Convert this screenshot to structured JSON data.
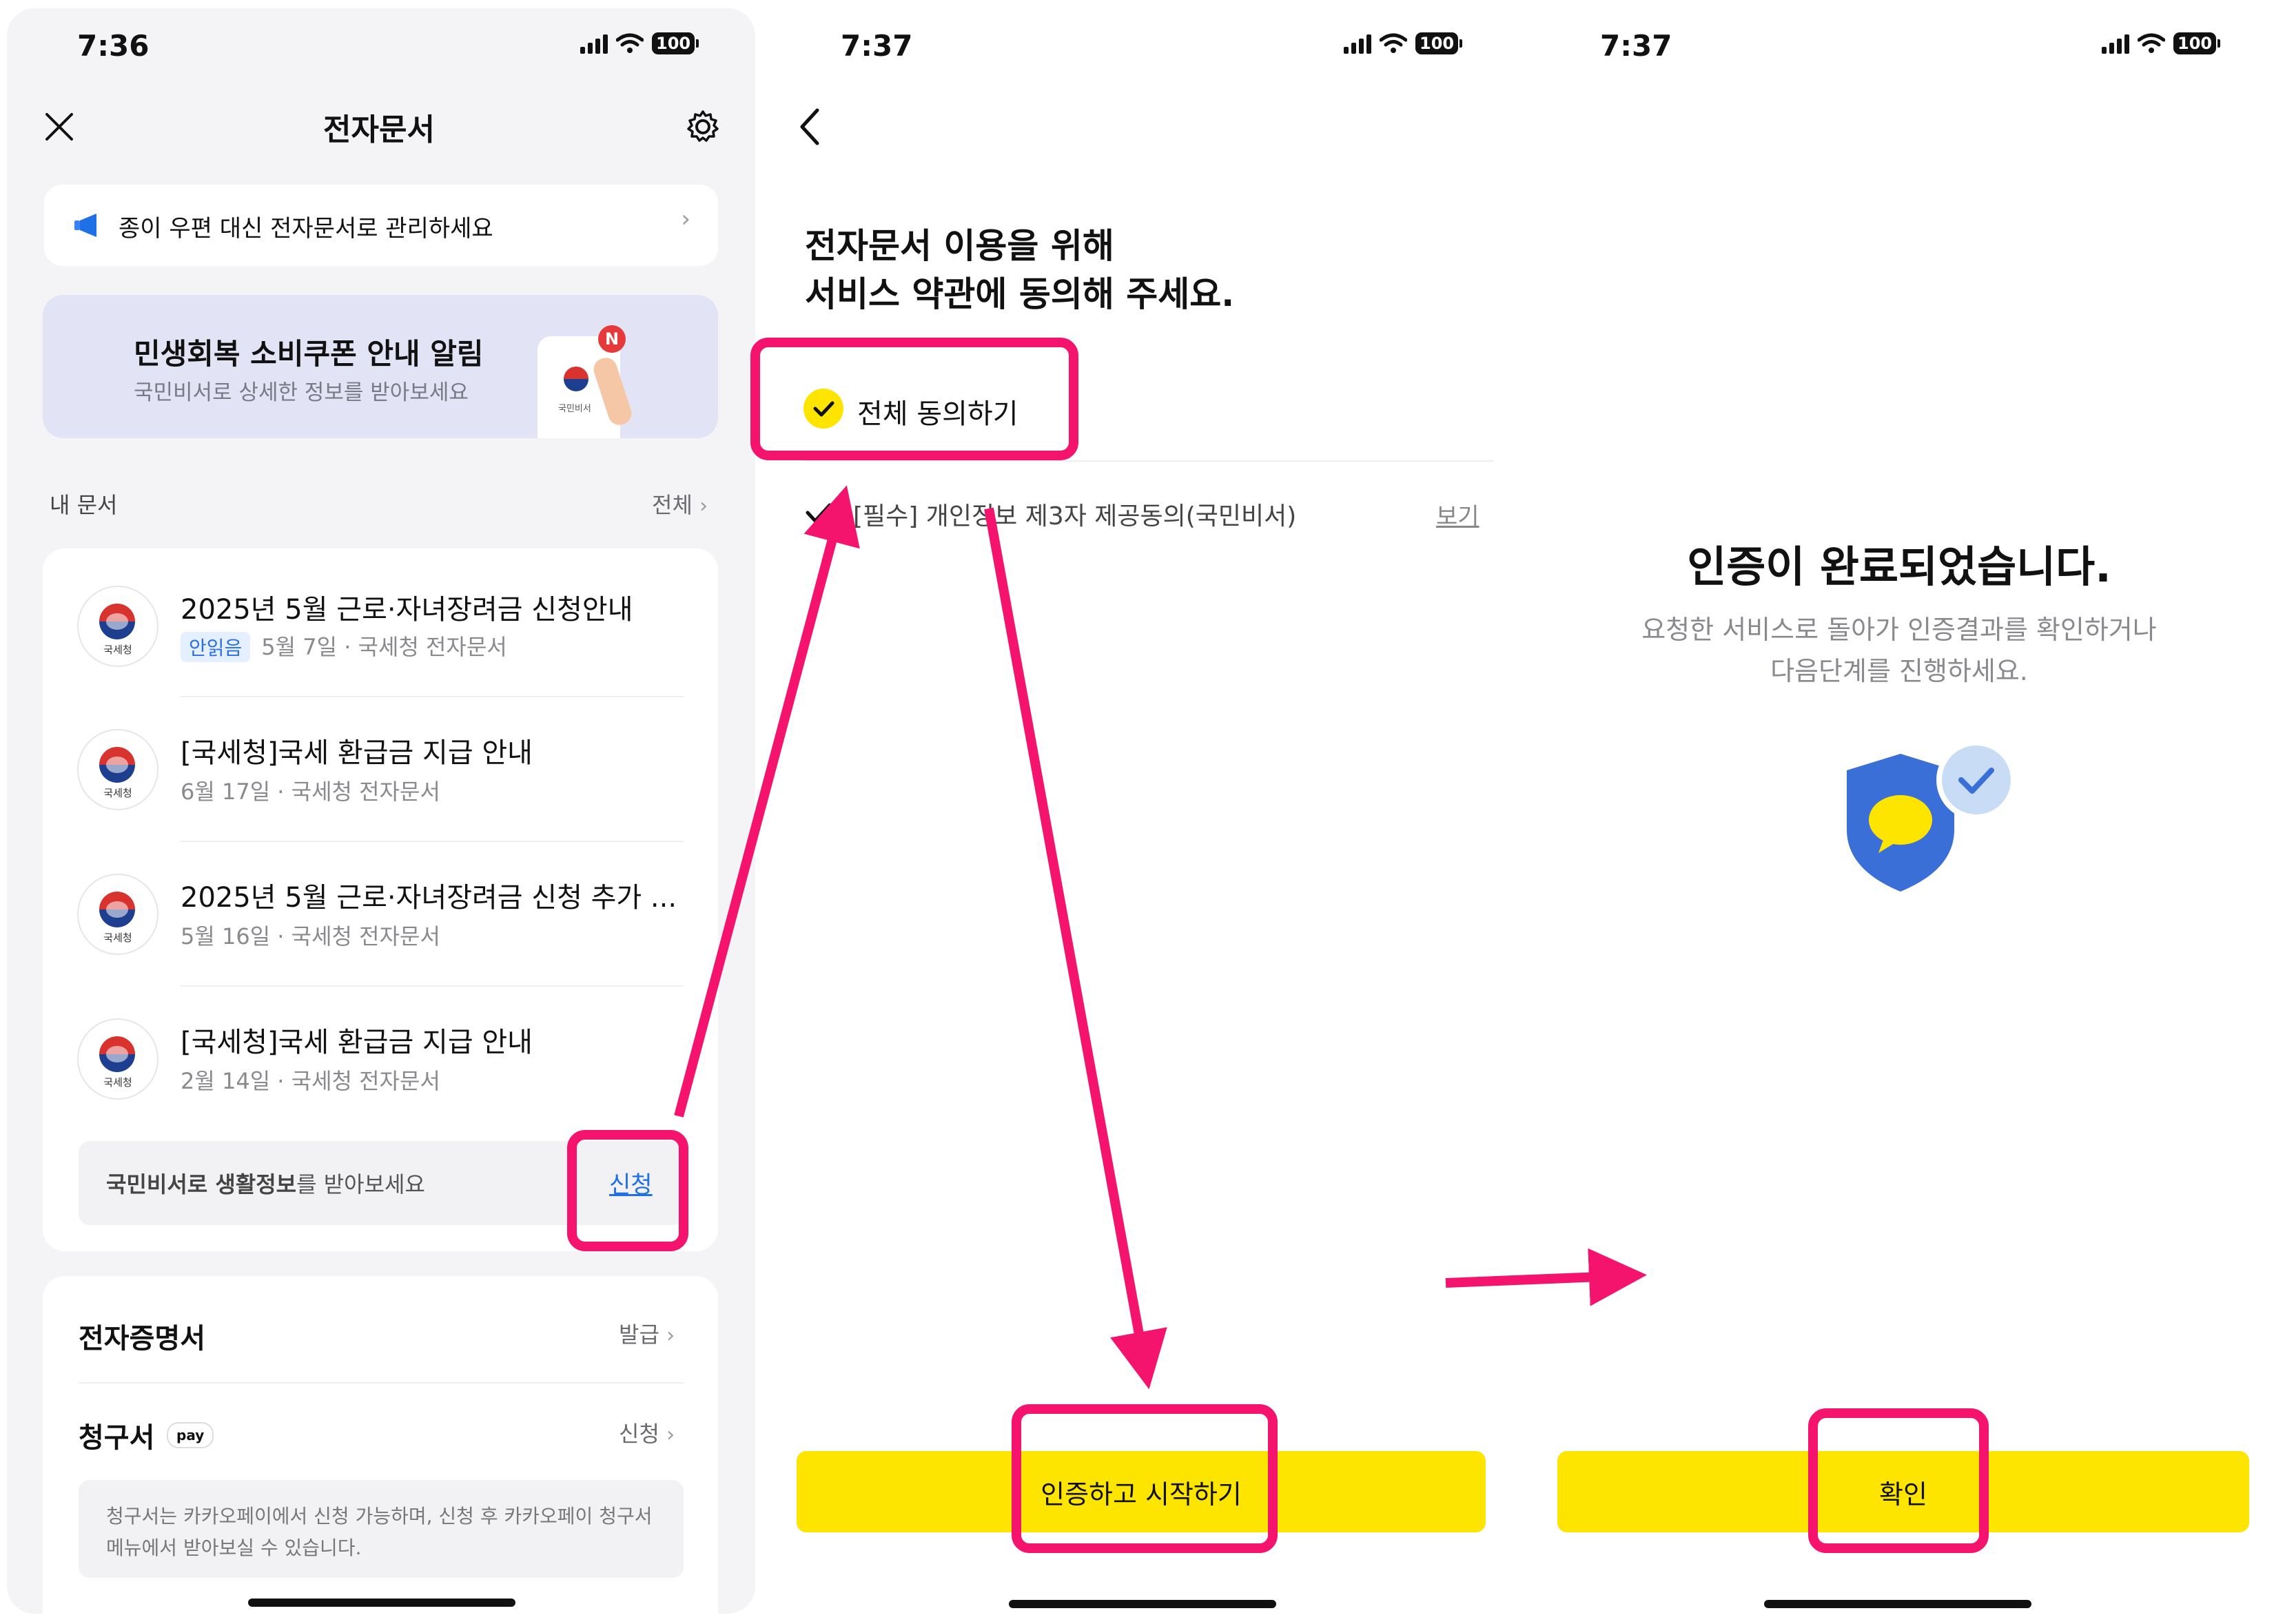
{
  "colors": {
    "accent_yellow": "#fee500",
    "highlight_pink": "#f5146d",
    "unread_blue": "#2c6fe0",
    "shield_blue": "#3b6fd8"
  },
  "screen1": {
    "time": "7:36",
    "battery": "100",
    "title": "전자문서",
    "notice": "종이 우편 대신 전자문서로 관리하세요",
    "banner": {
      "title": "민생회복 소비쿠폰 안내 알림",
      "subtitle": "국민비서로 상세한 정보를 받아보세요",
      "badge": "N",
      "phone_label": "국민비서"
    },
    "my_docs_label": "내 문서",
    "all_label": "전체",
    "docs": [
      {
        "title": "2025년 5월 근로·자녀장려금 신청안내",
        "unread": "안읽음",
        "meta": "5월 7일 · 국세청 전자문서",
        "seal": "국세청"
      },
      {
        "title": "[국세청]국세 환급금 지급 안내",
        "unread": "",
        "meta": "6월 17일 · 국세청 전자문서",
        "seal": "국세청"
      },
      {
        "title": "2025년 5월 근로·자녀장려금 신청 추가 ...",
        "unread": "",
        "meta": "5월 16일 · 국세청 전자문서",
        "seal": "국세청"
      },
      {
        "title": "[국세청]국세 환급금 지급 안내",
        "unread": "",
        "meta": "2월 14일 · 국세청 전자문서",
        "seal": "국세청"
      }
    ],
    "promo": {
      "bold": "국민비서로 생활정보",
      "rest": "를 받아보세요",
      "apply": "신청"
    },
    "cert": {
      "label": "전자증명서",
      "action": "발급"
    },
    "bill": {
      "label": "청구서",
      "badge": "pay",
      "action": "신청",
      "desc": "청구서는 카카오페이에서 신청 가능하며, 신청 후 카카오페이 청구서 메뉴에서 받아보실 수 있습니다."
    }
  },
  "screen2": {
    "time": "7:37",
    "battery": "100",
    "heading_line1": "전자문서 이용을 위해",
    "heading_line2": "서비스 약관에 동의해 주세요.",
    "agree_all": "전체 동의하기",
    "term": "[필수] 개인정보 제3자 제공동의(국민비서)",
    "term_view": "보기",
    "button": "인증하고 시작하기"
  },
  "screen3": {
    "time": "7:37",
    "battery": "100",
    "title": "인증이 완료되었습니다.",
    "desc_line1": "요청한 서비스로 돌아가 인증결과를 확인하거나",
    "desc_line2": "다음단계를 진행하세요.",
    "button": "확인"
  }
}
